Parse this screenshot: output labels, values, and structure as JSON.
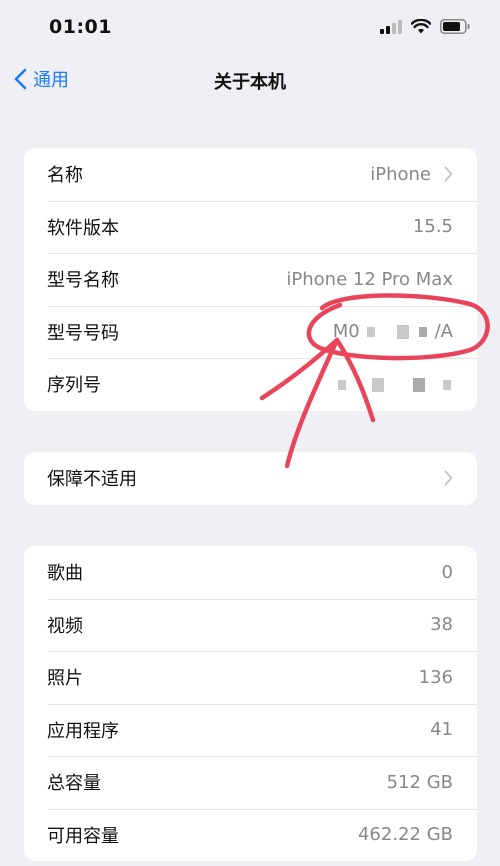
{
  "status_bar": {
    "time": "01:01",
    "icons": [
      "cellular-signal-icon",
      "wifi-icon",
      "battery-icon"
    ]
  },
  "nav": {
    "back_label": "通用",
    "title": "关于本机"
  },
  "info_group": [
    {
      "label": "名称",
      "value": "iPhone",
      "chevron": true
    },
    {
      "label": "软件版本",
      "value": "15.5"
    },
    {
      "label": "型号名称",
      "value": "iPhone 12 Pro Max"
    },
    {
      "label": "型号号码",
      "value_prefix": "M0",
      "value_suffix": "/A",
      "obscured": true
    },
    {
      "label": "序列号",
      "value": "",
      "obscured": true
    }
  ],
  "warranty_group": [
    {
      "label": "保障不适用",
      "chevron": true
    }
  ],
  "storage_group": [
    {
      "label": "歌曲",
      "value": "0"
    },
    {
      "label": "视频",
      "value": "38"
    },
    {
      "label": "照片",
      "value": "136"
    },
    {
      "label": "应用程序",
      "value": "41"
    },
    {
      "label": "总容量",
      "value": "512 GB"
    },
    {
      "label": "可用容量",
      "value": "462.22 GB"
    }
  ],
  "colors": {
    "accent": "#1a7cf5",
    "background": "#f0eff4",
    "annotation": "#e8455a"
  }
}
